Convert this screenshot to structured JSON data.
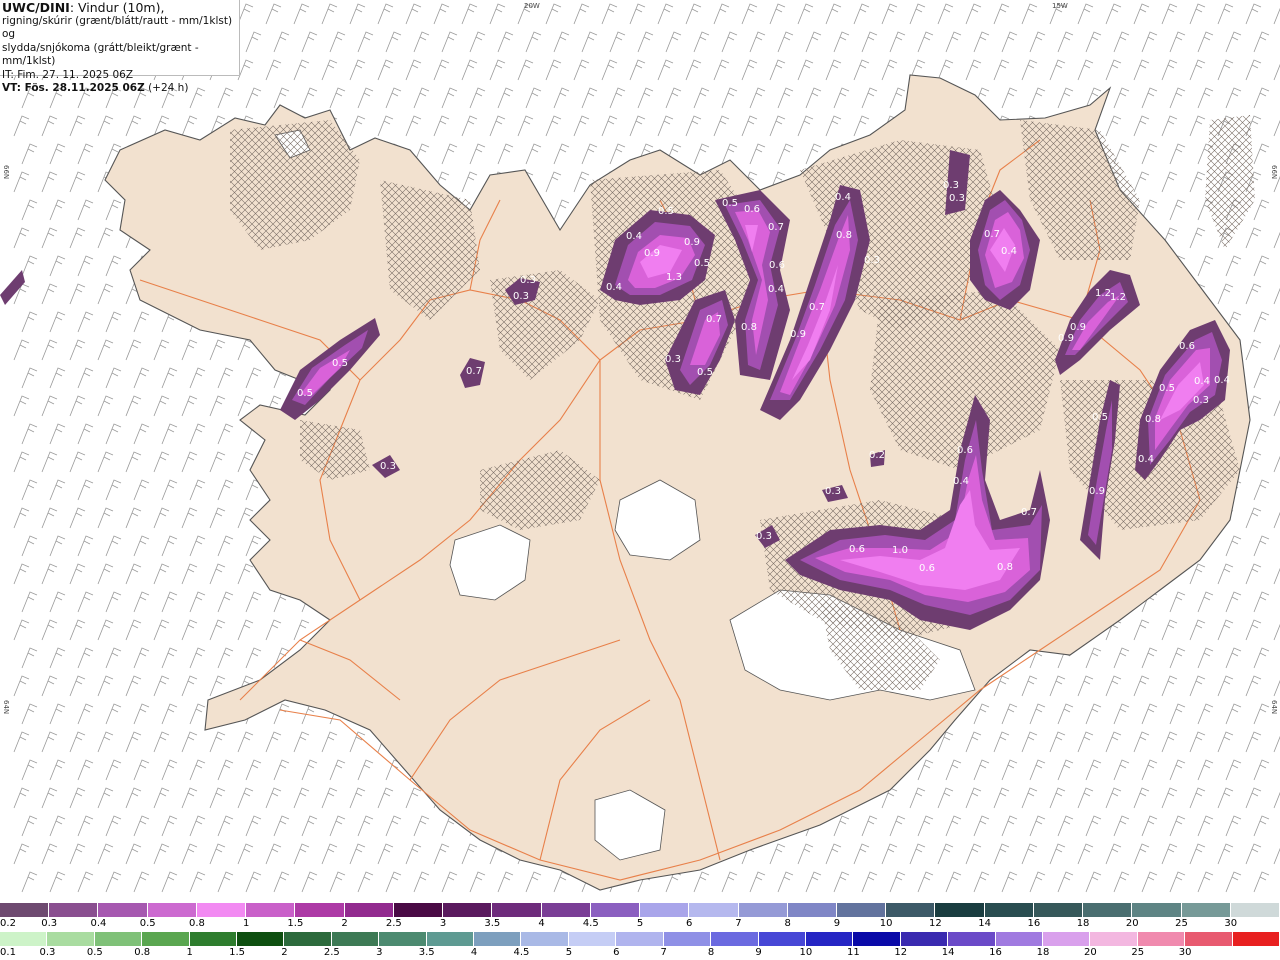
{
  "header": {
    "model": "UWC/DINI",
    "line1_rest": ": Vindur (10m),",
    "line2": "rigning/skúrir (grænt/blátt/rautt - mm/1klst) og",
    "line3": "slydda/snjókoma (grátt/bleikt/grænt - mm/1klst)",
    "line4": "IT: Fim. 27. 11. 2025 06Z",
    "line5_bold": "VT: Fös. 28.11.2025 06Z",
    "line5_rest": " (+24 h)"
  },
  "grid_labels": {
    "top1": "20W",
    "top2": "15W",
    "left1": "66N",
    "left2": "64N",
    "right1": "66N",
    "right2": "64N"
  },
  "colors": {
    "land": "#f2e1cf",
    "coast": "#555555",
    "road": "#e8804a",
    "barb": "#9a9a9a",
    "precip_dark": "#6e3d70",
    "precip_mid": "#a24fb0",
    "precip_light": "#d962d9",
    "precip_bright": "#f07ef0"
  },
  "precip_labels": [
    {
      "v": "0.5"
    },
    {
      "v": "0.5"
    },
    {
      "v": "0.7"
    },
    {
      "v": "0.3"
    },
    {
      "v": "0.3"
    },
    {
      "v": "0.3"
    },
    {
      "v": "0.4"
    },
    {
      "v": "0.5"
    },
    {
      "v": "0.9"
    },
    {
      "v": "0.9"
    },
    {
      "v": "1.3"
    },
    {
      "v": "0.5"
    },
    {
      "v": "0.4"
    },
    {
      "v": "0.5"
    },
    {
      "v": "0.6"
    },
    {
      "v": "0.7"
    },
    {
      "v": "0.6"
    },
    {
      "v": "0.4"
    },
    {
      "v": "0.7"
    },
    {
      "v": "0.8"
    },
    {
      "v": "0.3"
    },
    {
      "v": "0.5"
    },
    {
      "v": "0.4"
    },
    {
      "v": "0.8"
    },
    {
      "v": "0.7"
    },
    {
      "v": "0.9"
    },
    {
      "v": "0.3"
    },
    {
      "v": "0.3"
    },
    {
      "v": "0.3"
    },
    {
      "v": "0.7"
    },
    {
      "v": "0.4"
    },
    {
      "v": "1.2"
    },
    {
      "v": "1.2"
    },
    {
      "v": "0.9"
    },
    {
      "v": "0.9"
    },
    {
      "v": "0.6"
    },
    {
      "v": "0.5"
    },
    {
      "v": "0.4"
    },
    {
      "v": "0.4"
    },
    {
      "v": "0.3"
    },
    {
      "v": "0.8"
    },
    {
      "v": "0.5"
    },
    {
      "v": "0.4"
    },
    {
      "v": "0.9"
    },
    {
      "v": "0.2"
    },
    {
      "v": "0.3"
    },
    {
      "v": "0.6"
    },
    {
      "v": "0.4"
    },
    {
      "v": "0.7"
    },
    {
      "v": "0.3"
    },
    {
      "v": "0.6"
    },
    {
      "v": "1.0"
    },
    {
      "v": "0.6"
    },
    {
      "v": "0.8"
    }
  ],
  "legend_snow": {
    "colors": [
      "#6e4a70",
      "#8a4f90",
      "#a658b0",
      "#cc6ad0",
      "#f28af2",
      "#c960c9",
      "#ad3aa6",
      "#922a8f",
      "#4a0a45",
      "#5a1a5e",
      "#6e2b7c",
      "#7a3e96",
      "#8b5fc0",
      "#a9a5ea",
      "#b5b8ee",
      "#959ad6",
      "#7f86c6",
      "#62739e",
      "#3d5a68",
      "#1a3d40",
      "#294d50",
      "#36585a",
      "#4a6e70",
      "#5e8484",
      "#779a98",
      "#cfd9d9"
    ],
    "labels": [
      "0.2",
      "0.3",
      "0.4",
      "0.5",
      "0.8",
      "1",
      "1.5",
      "2",
      "2.5",
      "3",
      "3.5",
      "4",
      "4.5",
      "5",
      "6",
      "7",
      "8",
      "9",
      "10",
      "12",
      "14",
      "16",
      "18",
      "20",
      "25",
      "30"
    ]
  },
  "legend_rain": {
    "colors": [
      "#cdf3c8",
      "#a9dca0",
      "#7fc178",
      "#5aa650",
      "#2e7d2e",
      "#0e4f10",
      "#2c6a3c",
      "#3d7a55",
      "#4c8a70",
      "#5e9a92",
      "#7d9fbe",
      "#a9b9e6",
      "#c5cdf5",
      "#b0b4ee",
      "#8f90e6",
      "#6b6ae0",
      "#4747d6",
      "#2626c4",
      "#0a0aa8",
      "#3a2ab0",
      "#6b4ac8",
      "#a07ae0",
      "#d9a0ec",
      "#f3b7e0",
      "#f08aae",
      "#e85a70",
      "#e82020"
    ],
    "labels": [
      "0.1",
      "0.3",
      "0.5",
      "0.8",
      "1",
      "1.5",
      "2",
      "2.5",
      "3",
      "3.5",
      "4",
      "4.5",
      "5",
      "6",
      "7",
      "8",
      "9",
      "10",
      "11",
      "12",
      "14",
      "16",
      "18",
      "20",
      "25",
      "30"
    ]
  }
}
